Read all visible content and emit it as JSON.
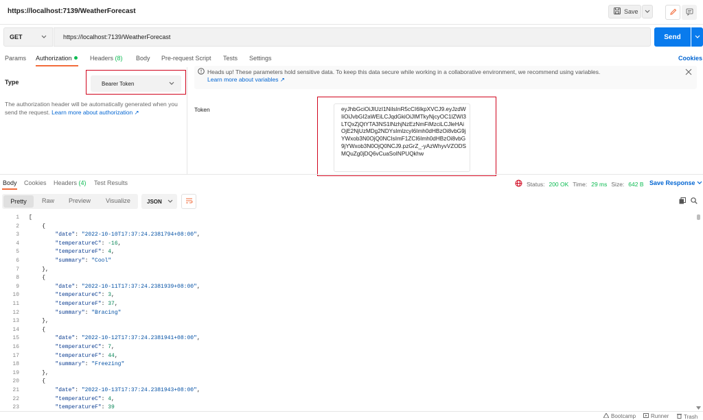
{
  "window": {
    "title": "https://localhost:7139/WeatherForecast"
  },
  "toolbar": {
    "save_label": "Save"
  },
  "request": {
    "method": "GET",
    "url": "https://localhost:7139/WeatherForecast",
    "send_label": "Send"
  },
  "request_tabs": [
    {
      "label": "Params"
    },
    {
      "label": "Authorization"
    },
    {
      "label": "Headers",
      "count": "(8)"
    },
    {
      "label": "Body"
    },
    {
      "label": "Pre-request Script"
    },
    {
      "label": "Tests"
    },
    {
      "label": "Settings"
    }
  ],
  "cookies_link": "Cookies",
  "auth": {
    "type_label": "Type",
    "type_value": "Bearer Token",
    "description": "The authorization header will be automatically generated when you send the request.",
    "description_link": "Learn more about authorization ↗",
    "banner_text": "Heads up! These parameters hold sensitive data. To keep this data secure while working in a collaborative environment, we recommend using variables.",
    "banner_link": "Learn more about variables ↗",
    "token_label": "Token",
    "token_value": "eyJhbGciOiJIUzI1NiIsInR5cCI6IkpXVCJ9.eyJzdWIiOiJvbGI2aWEiLCJqdGkiOiJlMTkyNjcyOC1lZWI3LTQxZjQtYTA3NS1lNzhjNzEzNmFiMzciLCJleHAiOjE2NjUzMDg2NDYsImlzcyI6Imh0dHBzOi8vbG9jYWxob3N0OjQ0NCIsImF1ZCI6Imh0dHBzOi8vbG9jYWxob3N0OjQ0NCJ9.pzGrZ_-yAzWhyvVZODSMQuZg0jDQ6vCuaSoINPUQkhw"
  },
  "response": {
    "tabs": [
      {
        "label": "Body"
      },
      {
        "label": "Cookies"
      },
      {
        "label": "Headers",
        "count": "(4)"
      },
      {
        "label": "Test Results"
      }
    ],
    "status_label": "Status:",
    "status_value": "200 OK",
    "time_label": "Time:",
    "time_value": "29 ms",
    "size_label": "Size:",
    "size_value": "642 B",
    "save_response": "Save Response",
    "views": [
      "Pretty",
      "Raw",
      "Preview",
      "Visualize"
    ],
    "format": "JSON",
    "lines": [
      "1",
      "2",
      "3",
      "4",
      "5",
      "6",
      "7",
      "8",
      "9",
      "10",
      "11",
      "12",
      "13",
      "14",
      "15",
      "16",
      "17",
      "18",
      "19",
      "20",
      "21",
      "22",
      "23"
    ],
    "items": [
      {
        "date": "\"2022-10-10T17:37:24.2381794+08:00\"",
        "temperatureC": "-16",
        "temperatureF": "4",
        "summary": "\"Cool\""
      },
      {
        "date": "\"2022-10-11T17:37:24.2381939+08:00\"",
        "temperatureC": "3",
        "temperatureF": "37",
        "summary": "\"Bracing\""
      },
      {
        "date": "\"2022-10-12T17:37:24.2381941+08:00\"",
        "temperatureC": "7",
        "temperatureF": "44",
        "summary": "\"Freezing\""
      },
      {
        "date": "\"2022-10-13T17:37:24.2381943+08:00\"",
        "temperatureC": "4",
        "temperatureF": "39"
      }
    ],
    "keys": {
      "date": "\"date\"",
      "temperatureC": "\"temperatureC\"",
      "temperatureF": "\"temperatureF\"",
      "summary": "\"summary\""
    }
  },
  "footer": {
    "bootcamp": "Bootcamp",
    "runner": "Runner",
    "trash": "Trash"
  },
  "colors": {
    "accent": "#f26b3a",
    "send": "#097bed",
    "link": "#0265d2",
    "ok": "#0cbb52",
    "highlight_box": "#d0021b"
  }
}
